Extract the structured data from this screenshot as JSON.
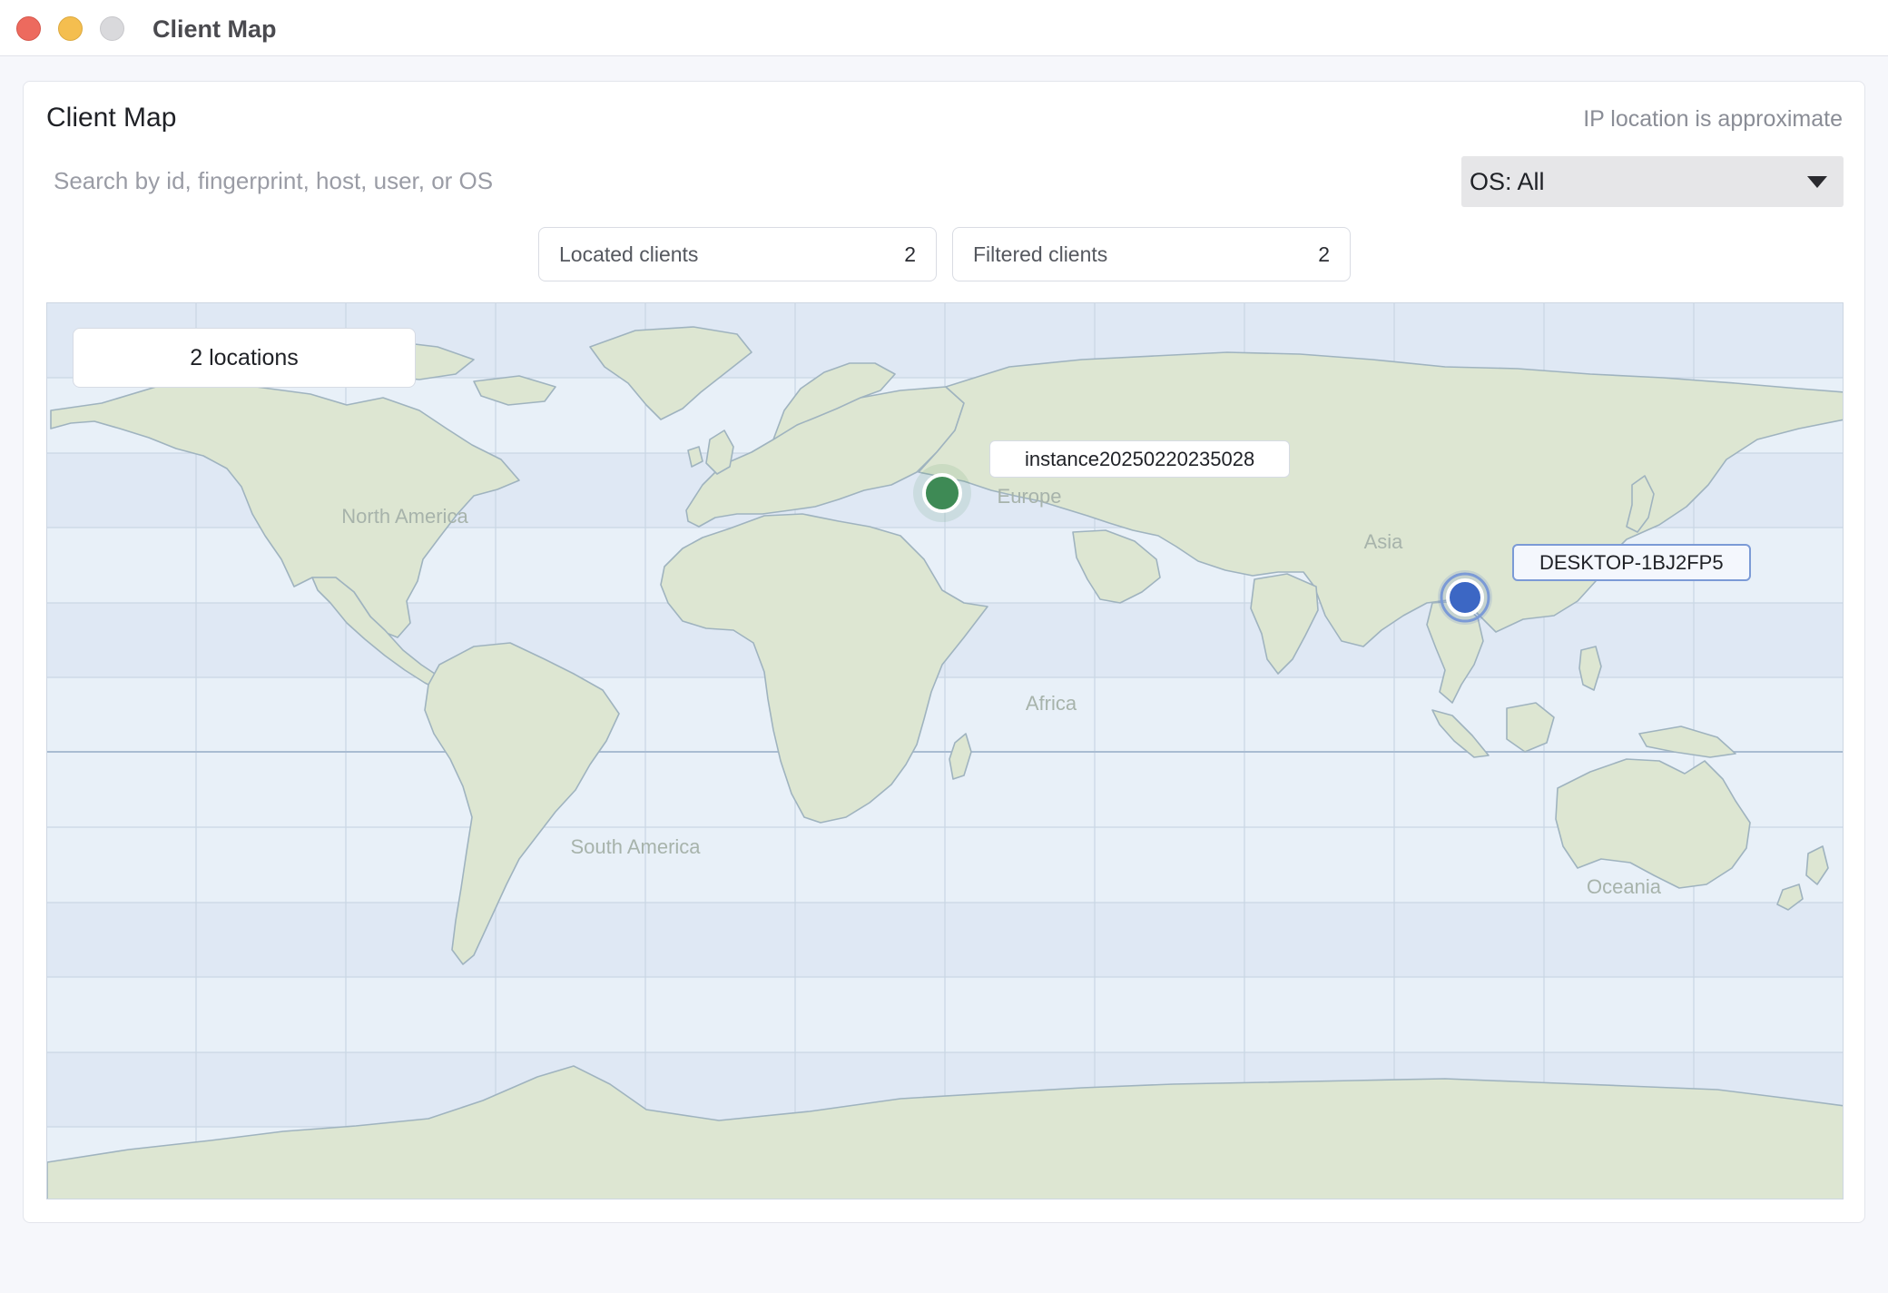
{
  "window": {
    "title": "Client Map"
  },
  "panel": {
    "title": "Client Map",
    "location_note": "IP location is approximate"
  },
  "search": {
    "placeholder": "Search by id, fingerprint, host, user, or OS",
    "value": ""
  },
  "os_filter": {
    "selected": "OS: All"
  },
  "stats": {
    "located_label": "Located clients",
    "located_value": "2",
    "filtered_label": "Filtered clients",
    "filtered_value": "2"
  },
  "map": {
    "location_count": "2 locations",
    "continents": [
      "North America",
      "South America",
      "Europe",
      "Africa",
      "Asia",
      "Oceania"
    ],
    "markers": [
      {
        "name": "instance20250220235028",
        "color": "#3e8a55",
        "lat": 51.5,
        "lon": -0.1
      },
      {
        "name": "DESKTOP-1BJ2FP5",
        "color": "#3c67c4",
        "lat": 30.6,
        "lon": 114.3
      }
    ]
  },
  "colors": {
    "ocean_light": "#e8f0f8",
    "ocean_band": "#dfe8f4",
    "land": "#dde6d2",
    "land_stroke": "#9fb3bf",
    "marker_green": "#3e8a55",
    "marker_blue": "#3c67c4"
  }
}
